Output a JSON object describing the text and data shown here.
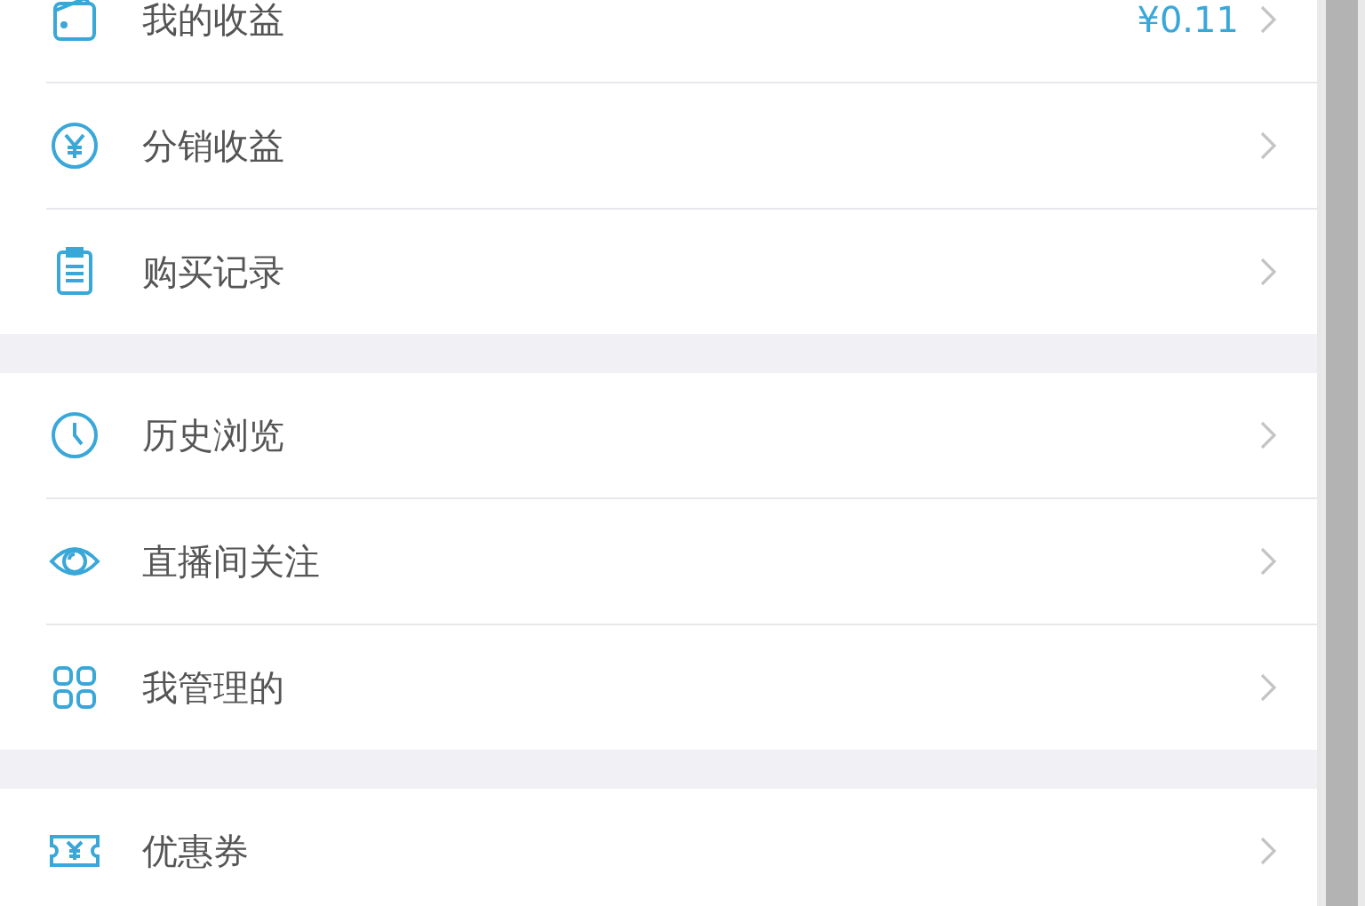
{
  "sections": [
    {
      "items": [
        {
          "label": "我的收益",
          "value": "¥0.11"
        },
        {
          "label": "分销收益"
        },
        {
          "label": "购买记录"
        }
      ]
    },
    {
      "items": [
        {
          "label": "历史浏览"
        },
        {
          "label": "直播间关注"
        },
        {
          "label": "我管理的"
        }
      ]
    },
    {
      "items": [
        {
          "label": "优惠券"
        }
      ]
    }
  ]
}
